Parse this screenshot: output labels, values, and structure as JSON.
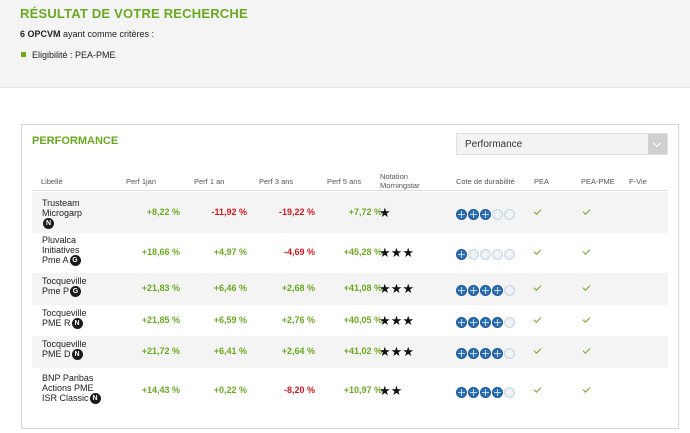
{
  "header": {
    "title": "RÉSULTAT DE VOTRE RECHERCHE",
    "count": "6 OPCVM",
    "summary_text": " ayant comme critères :",
    "criteria": [
      "Eligibilité : PEA-PME"
    ]
  },
  "panel": {
    "title": "PERFORMANCE",
    "select_value": "Performance"
  },
  "columns": {
    "libelle": "Libellé",
    "perf_1jan": "Perf 1jan",
    "perf_1an": "Perf 1 an",
    "perf_3ans": "Perf 3 ans",
    "perf_5ans": "Perf 5 ans",
    "notation_1": "Notation",
    "notation_2": "Morningstar",
    "durabilite": "Cote de durabilité",
    "pea": "PEA",
    "pea_pme": "PEA-PME",
    "fvie": "F-Vie"
  },
  "colors": {
    "accent": "#6aaa1e",
    "negative": "#d6181e",
    "globe": "#2a6fb5"
  },
  "rows": [
    {
      "lines": [
        "Trusteam",
        "Microgarp"
      ],
      "badge": "N",
      "p1jan": "+8,22 %",
      "p1an": "-11,92 %",
      "p3ans": "-19,22 %",
      "p5ans": "+7,72 %",
      "stars": 1,
      "globes": 3,
      "pea": true,
      "pea_pme": true
    },
    {
      "lines": [
        "Pluvalca",
        "Initiatives",
        "Pme A"
      ],
      "badge": "G",
      "p1jan": "+18,66 %",
      "p1an": "+4,97 %",
      "p3ans": "-4,69 %",
      "p5ans": "+45,28 %",
      "stars": 3,
      "globes": 1,
      "pea": true,
      "pea_pme": true
    },
    {
      "lines": [
        "Tocqueville",
        "Pme P"
      ],
      "badge": "G",
      "p1jan": "+21,83 %",
      "p1an": "+6,46 %",
      "p3ans": "+2,68 %",
      "p5ans": "+41,08 %",
      "stars": 3,
      "globes": 4,
      "pea": true,
      "pea_pme": true
    },
    {
      "lines": [
        "Tocqueville",
        "PME R"
      ],
      "badge": "N",
      "p1jan": "+21,85 %",
      "p1an": "+6,59 %",
      "p3ans": "+2,76 %",
      "p5ans": "+40,05 %",
      "stars": 3,
      "globes": 4,
      "pea": true,
      "pea_pme": true
    },
    {
      "lines": [
        "Tocqueville",
        "PME D"
      ],
      "badge": "N",
      "p1jan": "+21,72 %",
      "p1an": "+6,41 %",
      "p3ans": "+2,64 %",
      "p5ans": "+41,02 %",
      "stars": 3,
      "globes": 4,
      "pea": true,
      "pea_pme": true
    },
    {
      "lines": [
        "BNP Paribas",
        "Actions PME",
        "ISR Classic"
      ],
      "badge": "N",
      "p1jan": "+14,43 %",
      "p1an": "+0,22 %",
      "p3ans": "-8,20 %",
      "p5ans": "+10,97 %",
      "stars": 2,
      "globes": 4,
      "pea": true,
      "pea_pme": true
    }
  ]
}
